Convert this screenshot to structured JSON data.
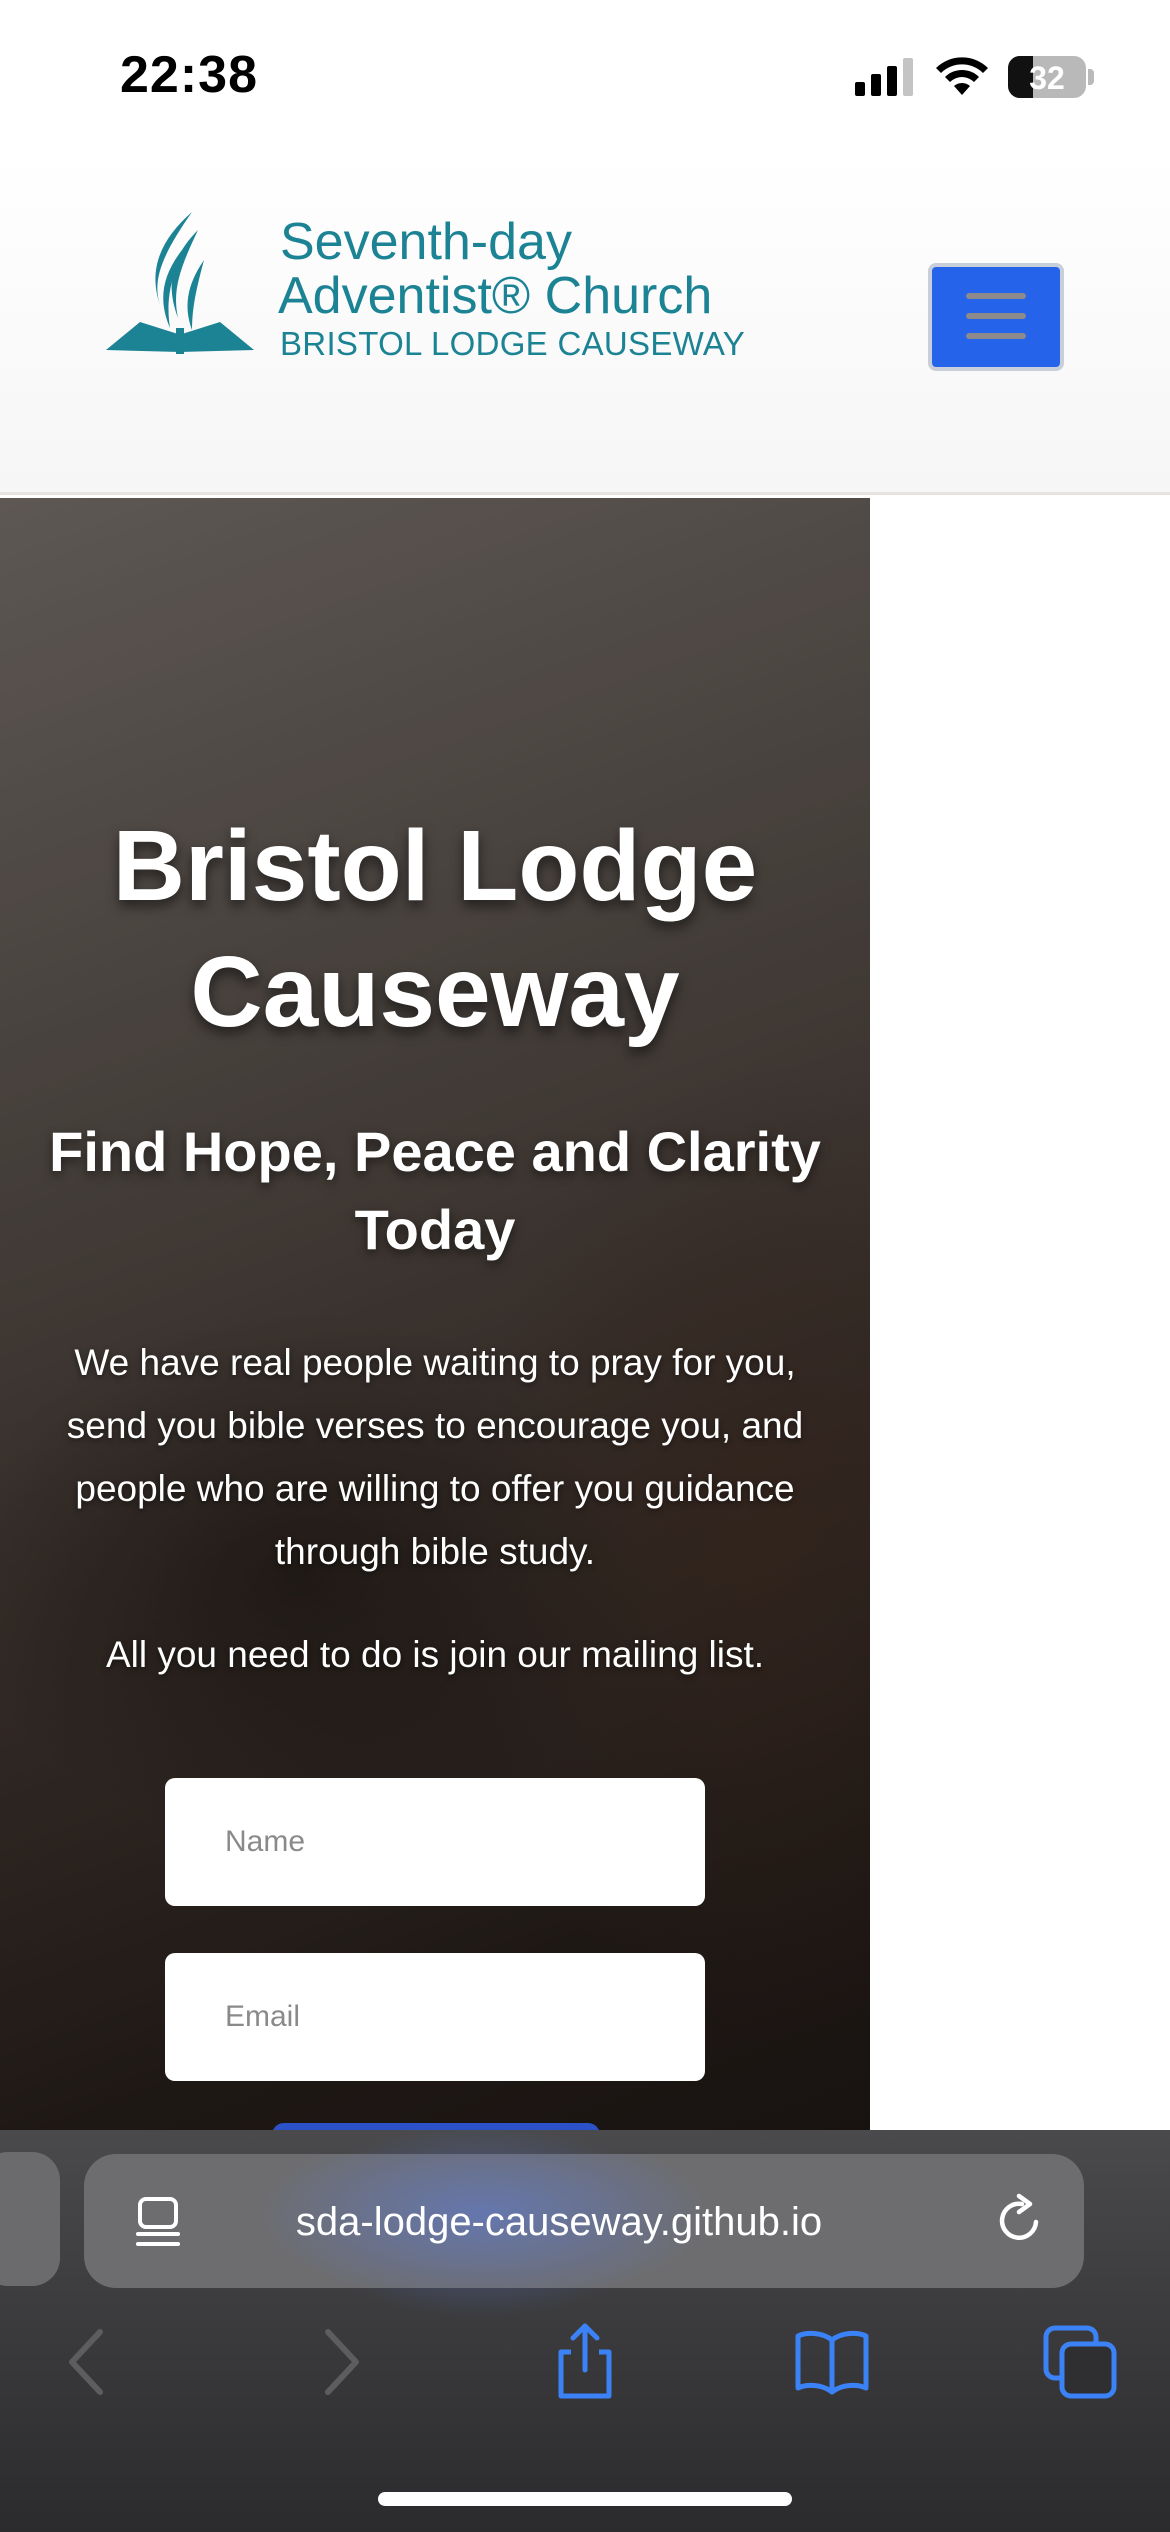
{
  "status_bar": {
    "time": "22:38",
    "battery_level": "32",
    "battery_percent": 32
  },
  "header": {
    "logo": {
      "line1": "Seventh-day",
      "line2": "Adventist® Church",
      "line3": "BRISTOL LODGE CAUSEWAY"
    },
    "menu_icon": "hamburger-icon",
    "accent_color": "#2563eb",
    "logo_color": "#1c8394"
  },
  "hero": {
    "title": "Bristol Lodge Causeway",
    "subtitle": "Find Hope, Peace and Clarity Today",
    "description": "We have real people waiting to pray for you, send you bible verses to encourage you, and people who are willing to offer you guidance through bible study.",
    "cta": "All you need to do is join our mailing list.",
    "form": {
      "name_placeholder": "Name",
      "email_placeholder": "Email"
    }
  },
  "browser": {
    "url": "sda-lodge-causeway.github.io",
    "icons": [
      "page-menu-icon",
      "reload-icon",
      "back-icon",
      "forward-icon",
      "share-icon",
      "bookmarks-icon",
      "tabs-icon"
    ]
  }
}
